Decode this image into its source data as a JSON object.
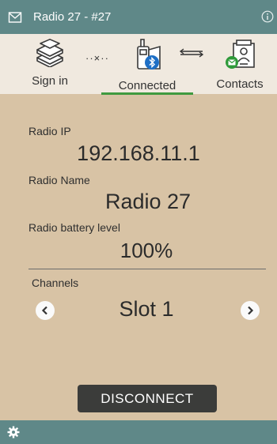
{
  "header": {
    "title": "Radio 27 - #27",
    "icons": {
      "left": "mail-icon",
      "right": "info-icon"
    }
  },
  "steps": [
    {
      "label": "Sign in",
      "icon": "server-stack-icon"
    },
    {
      "label": "Connected",
      "icon": "radio-bluetooth-icon",
      "active": true
    },
    {
      "label": "Contacts",
      "icon": "contacts-card-icon"
    }
  ],
  "steps_connector": {
    "left": "··×··"
  },
  "radio": {
    "ip_label": "Radio IP",
    "ip_value": "192.168.11.1",
    "name_label": "Radio Name",
    "name_value": "Radio 27",
    "battery_label": "Radio battery level",
    "battery_value": "100%"
  },
  "channels": {
    "label": "Channels",
    "selected": "Slot 1"
  },
  "actions": {
    "disconnect": "DISCONNECT"
  },
  "footer": {
    "icon": "gear-icon"
  },
  "colors": {
    "header_bg": "#5f8888",
    "steps_bg": "#f0e9df",
    "body_bg": "#d8c3a5",
    "active_underline": "#3f9a3f",
    "button_bg": "#3b3c3a"
  }
}
